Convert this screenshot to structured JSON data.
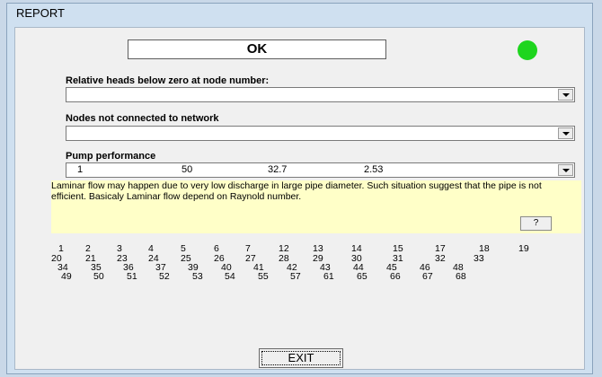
{
  "window": {
    "title": "REPORT"
  },
  "status": {
    "text": "OK",
    "indicator_color": "#1ed51e"
  },
  "relative_heads": {
    "label": "Relative heads below zero at node number:",
    "value": ""
  },
  "not_connected": {
    "label": "Nodes not connected to network",
    "value": ""
  },
  "pump": {
    "label": "Pump performance",
    "values": [
      "1",
      "50",
      "32.7",
      "2.53"
    ]
  },
  "note": {
    "text": "Laminar flow may happen due to very low discharge in large pipe diameter. Such situation suggest that the pipe is not efficient. Basicaly Laminar flow depend on Raynold number.",
    "help_label": "?"
  },
  "nodes": {
    "row1": [
      "1",
      "2",
      "3",
      "4",
      "5",
      "6",
      "7",
      "12",
      "13",
      "14",
      "15",
      "17",
      "18",
      "19"
    ],
    "row2": [
      "20",
      "21",
      "23",
      "24",
      "25",
      "26",
      "27",
      "28",
      "29",
      "30",
      "31",
      "32",
      "33"
    ],
    "row3": [
      "34",
      "35",
      "36",
      "37",
      "39",
      "40",
      "41",
      "42",
      "43",
      "44",
      "45",
      "46",
      "48"
    ],
    "row4": [
      "49",
      "50",
      "51",
      "52",
      "53",
      "54",
      "55",
      "57",
      "61",
      "65",
      "66",
      "67",
      "68"
    ]
  },
  "exit_label": "EXIT"
}
